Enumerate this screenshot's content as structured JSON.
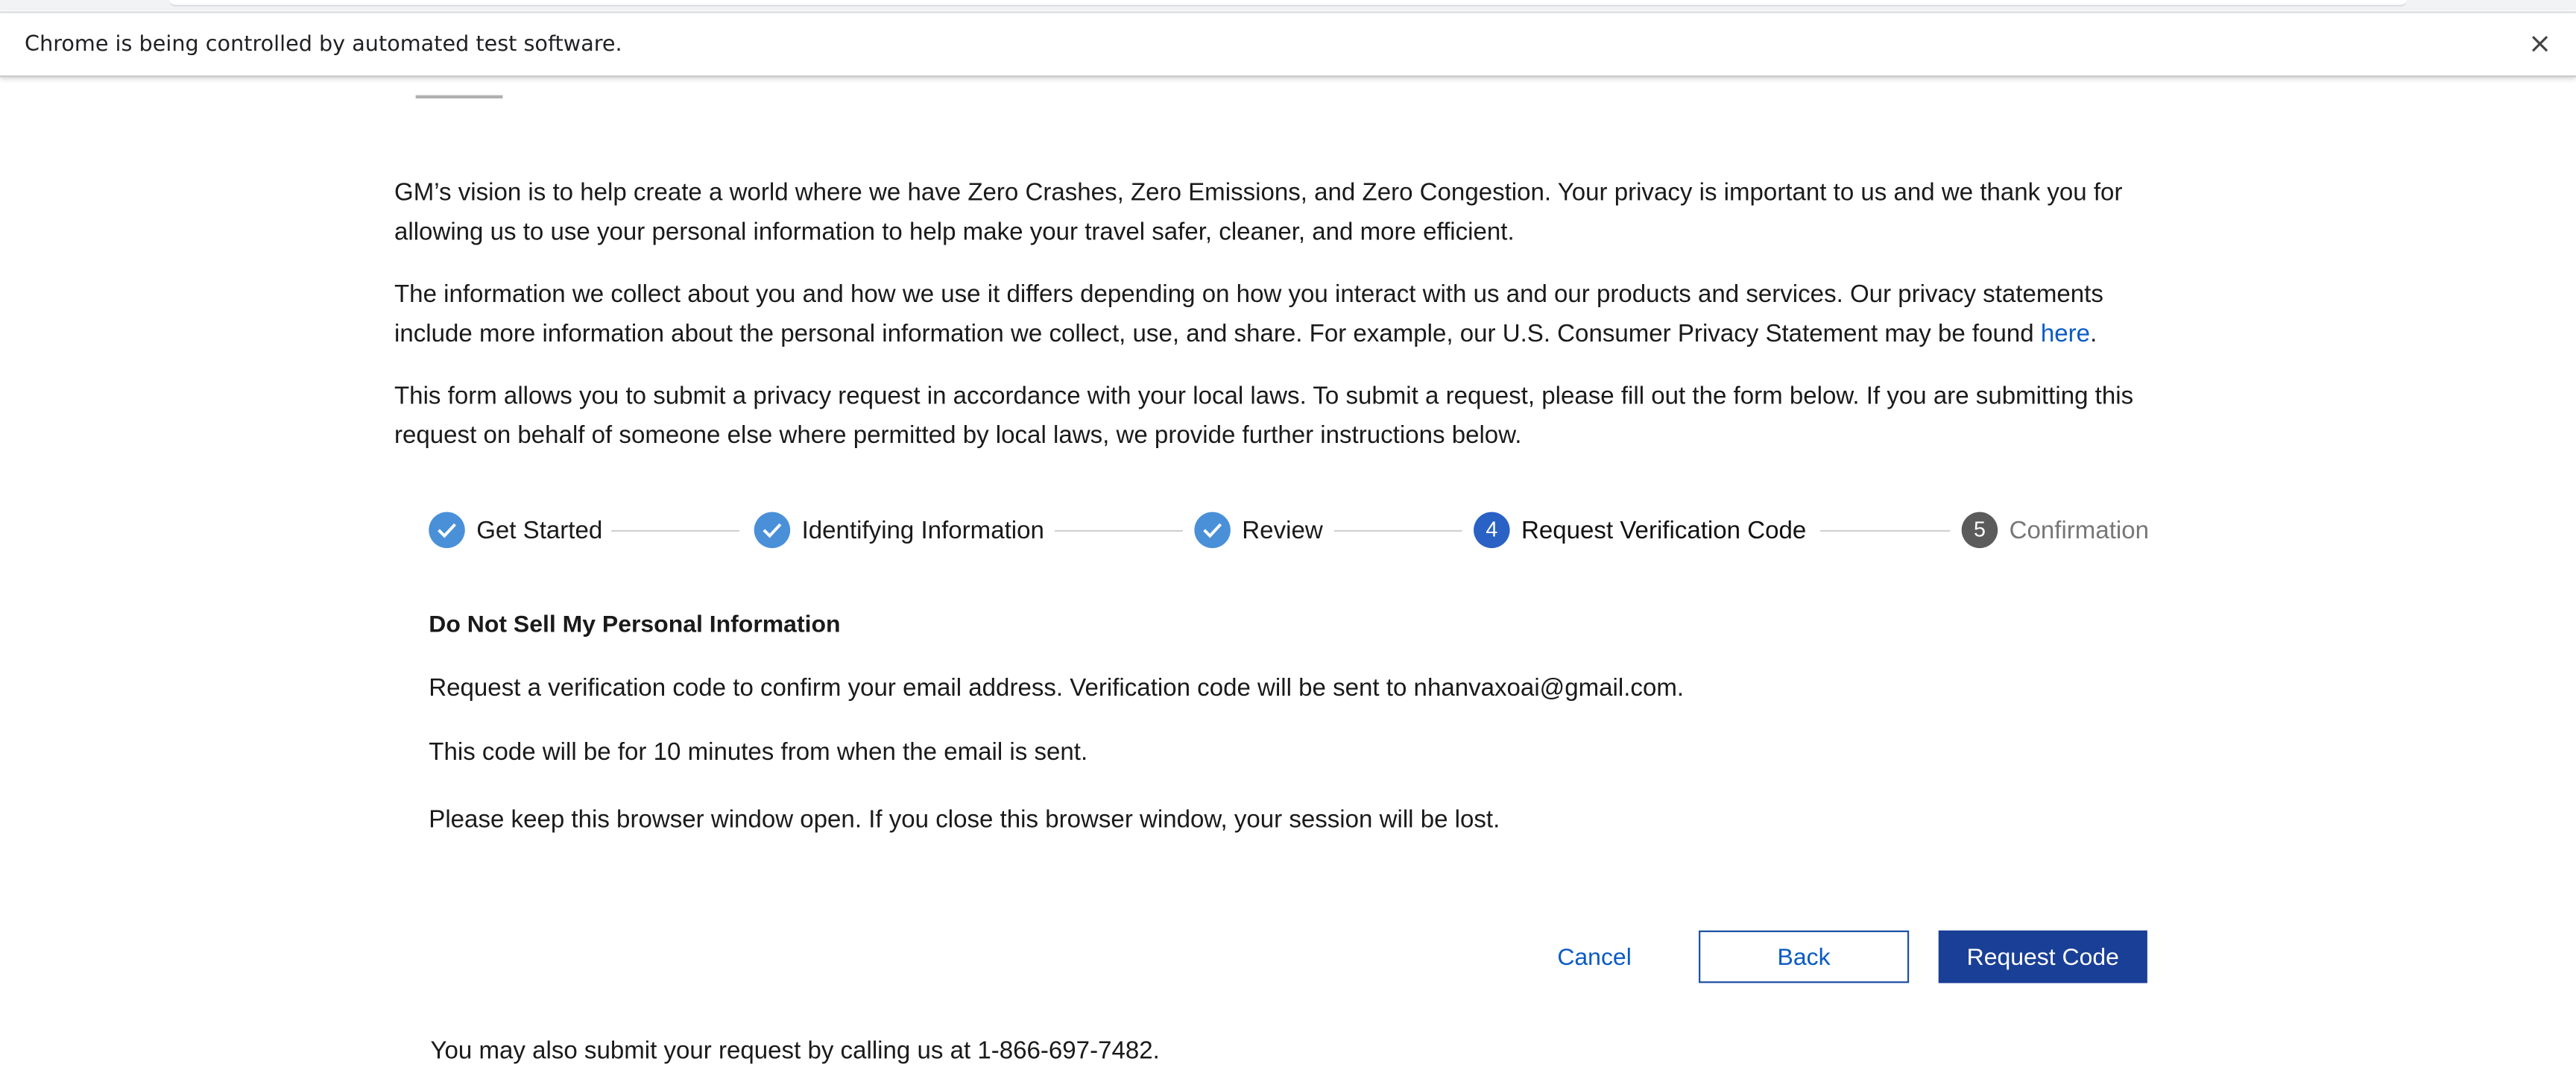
{
  "browser": {
    "automation_banner": "Chrome is being controlled by automated test software.",
    "close_symbol": "×"
  },
  "intro": {
    "paragraph_1": "GM’s vision is to help create a world where we have Zero Crashes, Zero Emissions, and Zero Congestion. Your privacy is important to us and we thank you for allowing us to use your personal information to help make your travel safer, cleaner, and more efficient.",
    "paragraph_2_text": "The information we collect about you and how we use it differs depending on how you interact with us and our products and services. Our privacy statements include more information about the personal information we collect, use, and share. For example, our U.S. Consumer Privacy Statement may be found ",
    "paragraph_2_link": "here",
    "paragraph_2_end": ".",
    "paragraph_3": "This form allows you to submit a privacy request in accordance with your local laws. To submit a request, please fill out the form below. If you are submitting this request on behalf of someone else where permitted by local laws, we provide further instructions below."
  },
  "stepper": {
    "steps": [
      {
        "label": "Get Started",
        "state": "complete"
      },
      {
        "label": "Identifying Information",
        "state": "complete"
      },
      {
        "label": "Review",
        "state": "complete"
      },
      {
        "label": "Request Verification Code",
        "state": "current",
        "number": "4"
      },
      {
        "label": "Confirmation",
        "state": "upcoming",
        "number": "5"
      }
    ]
  },
  "section": {
    "heading": "Do Not Sell My Personal Information",
    "line_1": "Request a verification code to confirm your email address. Verification code will be sent to nhanvaxoai@gmail.com.",
    "line_2": "This code will be for 10 minutes from when the email is sent.",
    "line_3": "Please keep this browser window open. If you close this browser window, your session will be lost."
  },
  "actions": {
    "cancel_label": "Cancel",
    "back_label": "Back",
    "request_label": "Request Code"
  },
  "footer": {
    "phone_note": "You may also submit your request by calling us at 1-866-697-7482."
  },
  "colors": {
    "link": "#0a5bc4",
    "step_complete": "#4a90d9",
    "step_current": "#2962c4",
    "step_upcoming": "#5b5b5b",
    "primary_button": "#1a3f96"
  }
}
